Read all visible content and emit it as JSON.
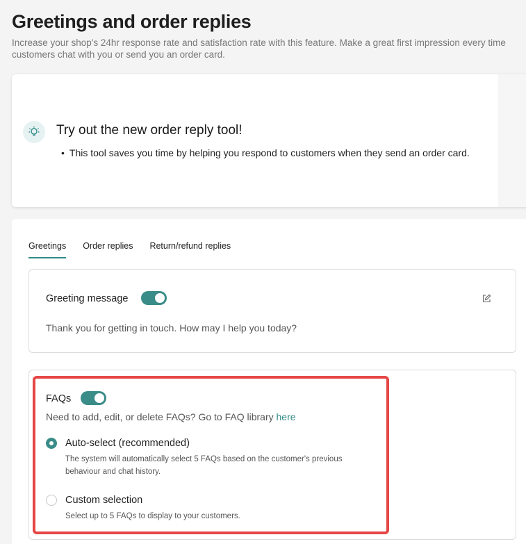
{
  "page": {
    "title": "Greetings and order replies",
    "description": "Increase your shop's 24hr response rate and satisfaction rate with this feature. Make a great first impression every time customers chat with you or send you an order card."
  },
  "promo": {
    "title": "Try out the new order reply tool!",
    "bullet": "This tool saves you time by helping you respond to customers when they send an order card.",
    "icon": "lightbulb-icon"
  },
  "tabs": [
    {
      "label": "Greetings",
      "active": true
    },
    {
      "label": "Order replies",
      "active": false
    },
    {
      "label": "Return/refund replies",
      "active": false
    }
  ],
  "greeting": {
    "label": "Greeting message",
    "enabled": true,
    "message": "Thank you for getting in touch. How may I help you today?",
    "edit_icon": "edit-icon"
  },
  "faqs": {
    "label": "FAQs",
    "enabled": true,
    "hint_prefix": "Need to add, edit, or delete FAQs? Go to FAQ library ",
    "hint_link": "here",
    "options": [
      {
        "title": "Auto-select (recommended)",
        "desc": "The system will automatically select 5 FAQs based on the customer's previous behaviour and chat history.",
        "selected": true
      },
      {
        "title": "Custom selection",
        "desc": "Select up to 5 FAQs to display to your customers.",
        "selected": false
      }
    ]
  },
  "colors": {
    "accent": "#3a8c88",
    "highlight": "#e64646"
  }
}
